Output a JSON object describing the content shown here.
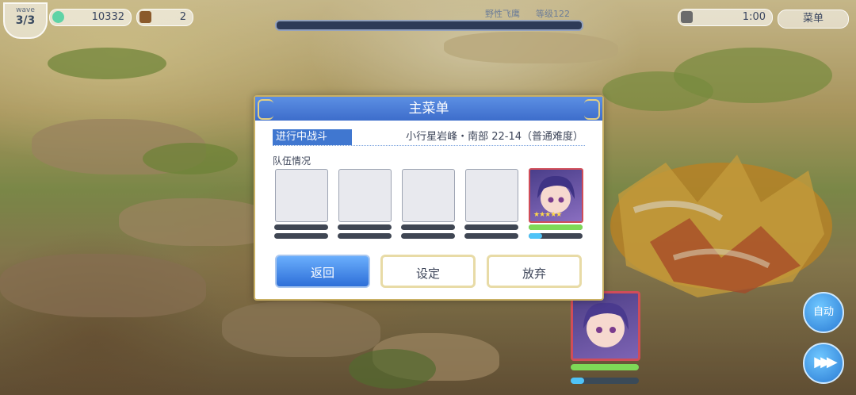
{
  "hud": {
    "wave_label": "wave",
    "wave_value": "3/3",
    "currency_value": "10332",
    "chest_value": "2",
    "boss_name": "野性飞鹰",
    "boss_level": "等级122",
    "timer": "1:00",
    "menu_label": "菜单",
    "auto_label": "自动",
    "speed_label": "▶▶▶"
  },
  "dialog": {
    "title": "主菜单",
    "battle_tag": "进行中战斗",
    "battle_name": "小行星岩峰・南部 22-14（普通难度）",
    "team_label": "队伍情况",
    "buttons": {
      "back": "返回",
      "settings": "设定",
      "give_up": "放弃"
    }
  },
  "team": {
    "slots": [
      {
        "filled": false
      },
      {
        "filled": false
      },
      {
        "filled": false
      },
      {
        "filled": false
      },
      {
        "filled": true,
        "stars": "★★★★★",
        "hp": 1.0,
        "tp": 0.25
      }
    ]
  },
  "colors": {
    "accent": "#3d6dcb",
    "hp": "#7ed957",
    "tp": "#4fc3f7",
    "frame": "#c9b064"
  }
}
